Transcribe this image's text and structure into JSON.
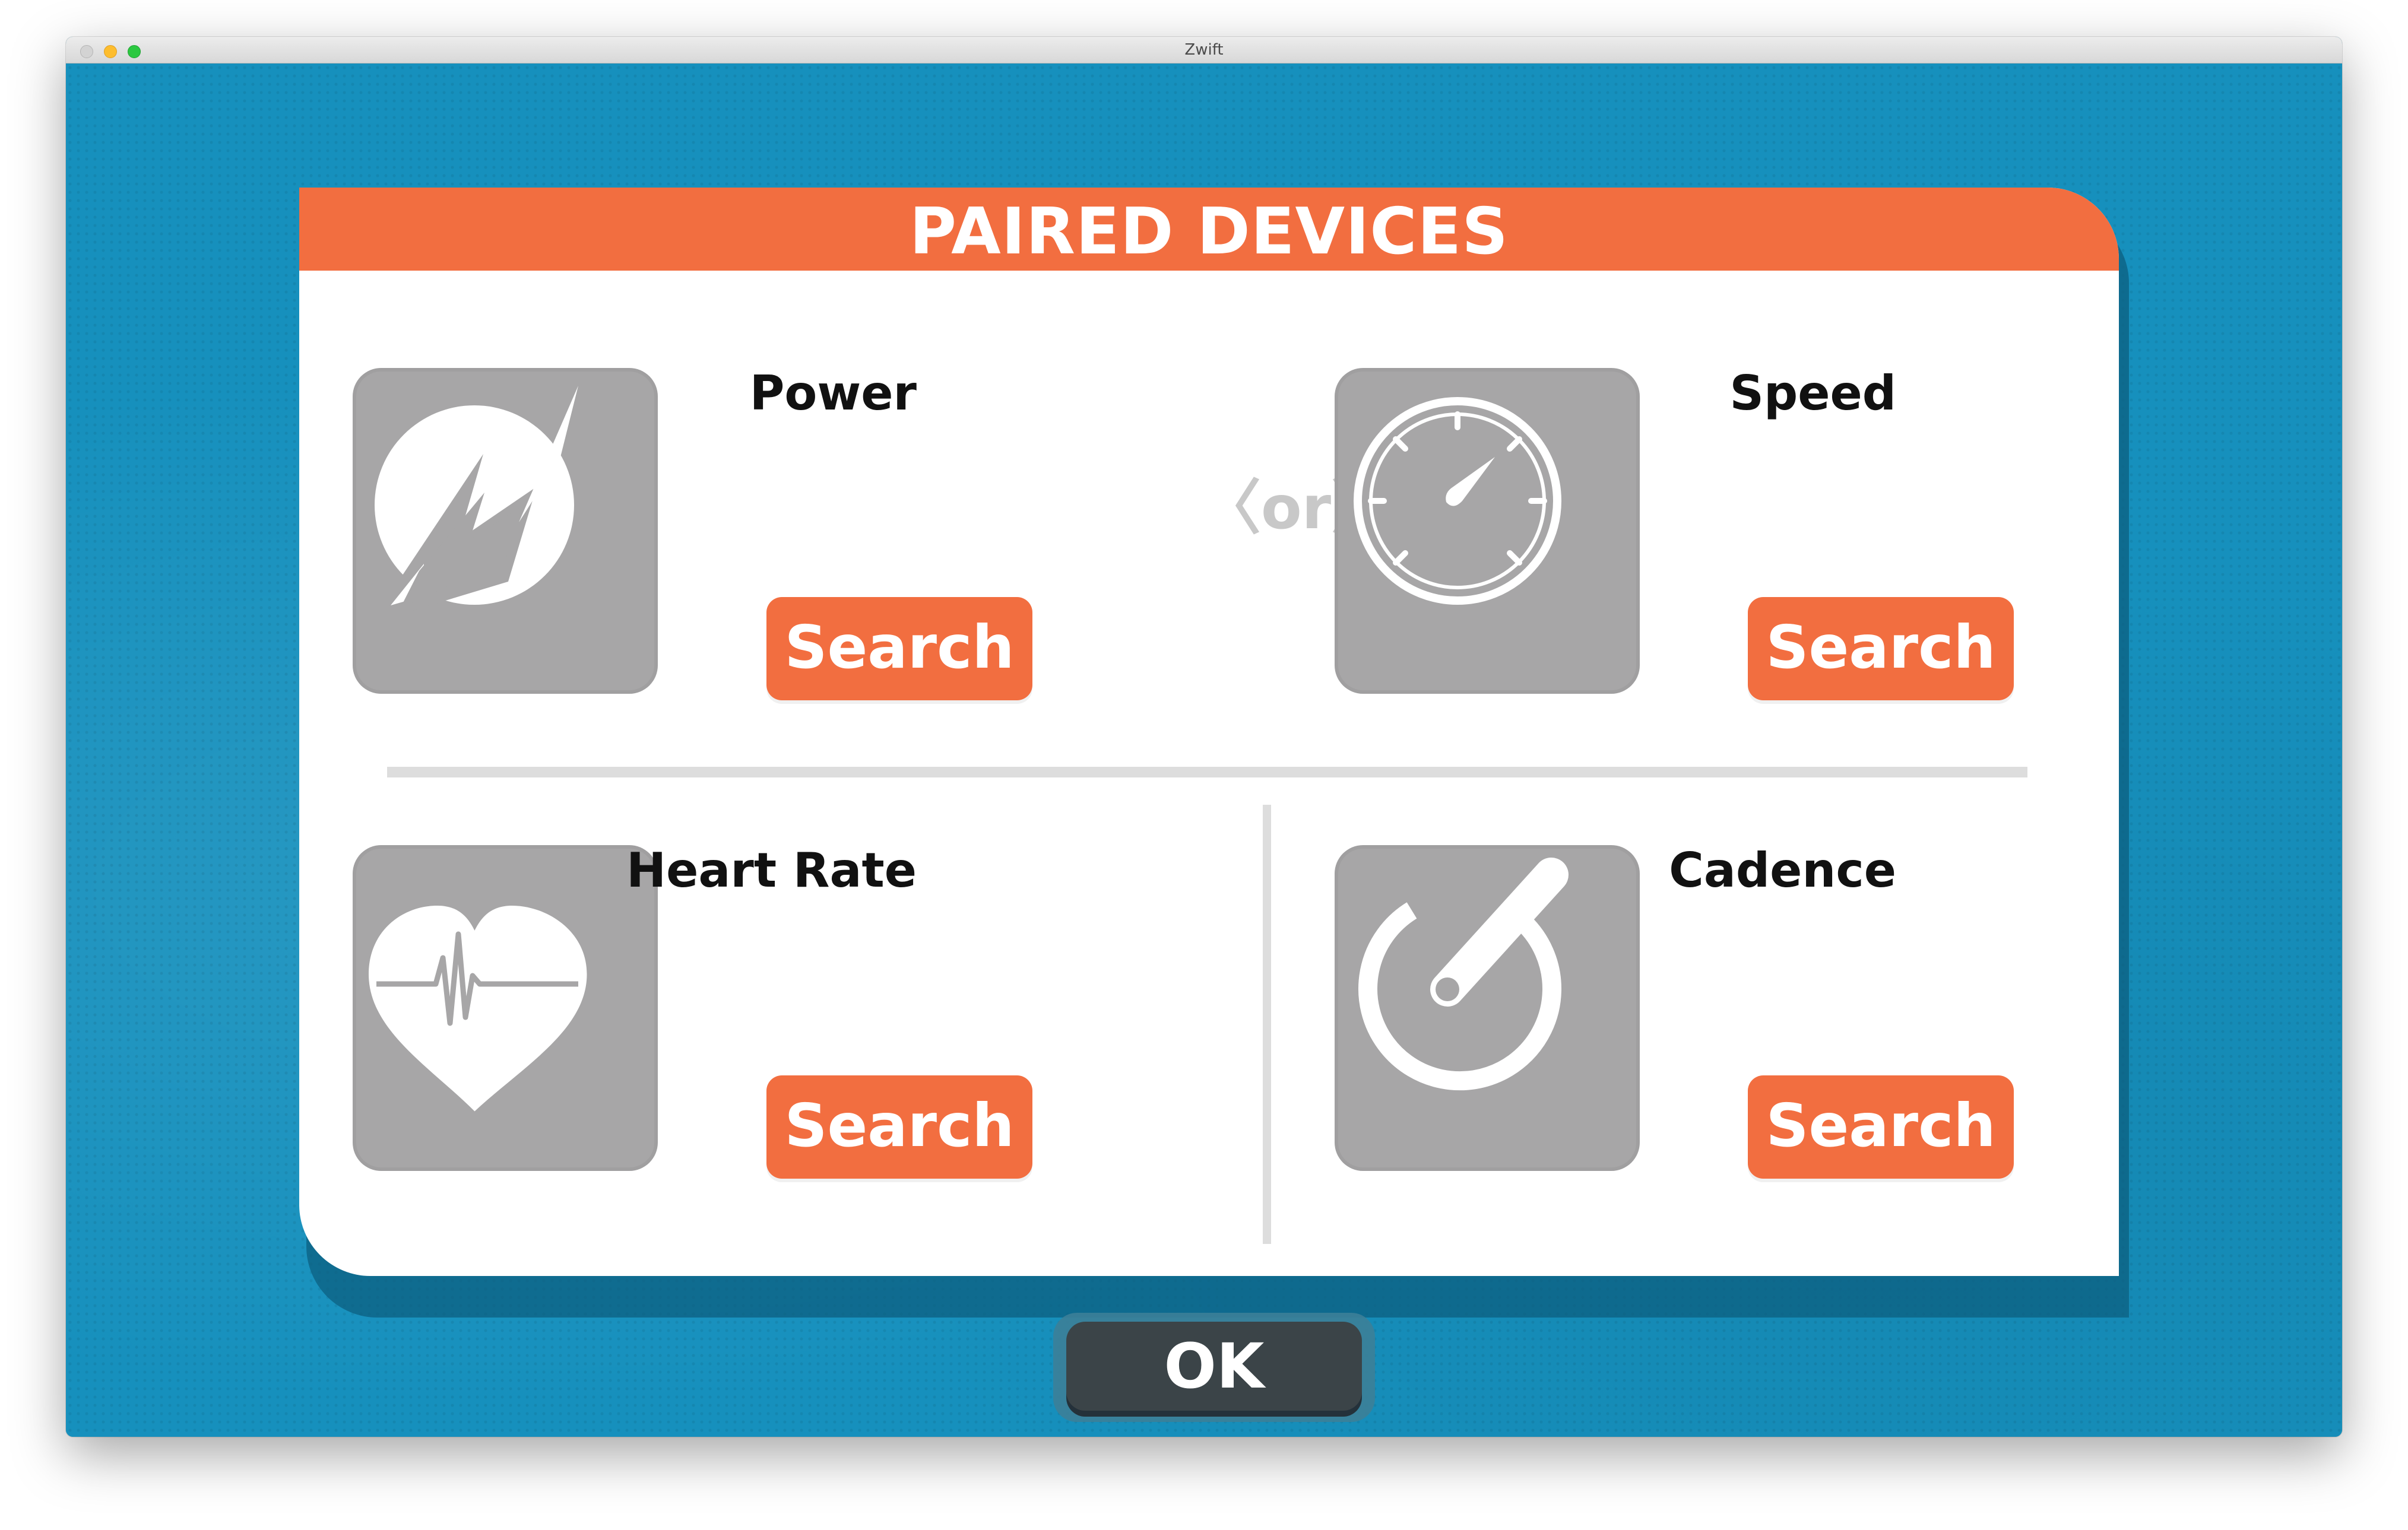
{
  "window": {
    "title": "Zwift"
  },
  "dialog": {
    "title": "PAIRED DEVICES",
    "or_label": "〈or〉",
    "devices": [
      {
        "label": "Power",
        "icon": "power-bolt-icon",
        "button": "Search"
      },
      {
        "label": "Speed",
        "icon": "speedometer-icon",
        "button": "Search"
      },
      {
        "label": "Heart Rate",
        "icon": "heart-rate-icon",
        "button": "Search"
      },
      {
        "label": "Cadence",
        "icon": "cadence-crank-icon",
        "button": "Search"
      }
    ]
  },
  "ok_button": {
    "label": "OK"
  },
  "colors": {
    "accent": "#f26e40",
    "background": "#1690bd",
    "icon_tile": "#a7a6a7",
    "ok": "#3b4448"
  }
}
